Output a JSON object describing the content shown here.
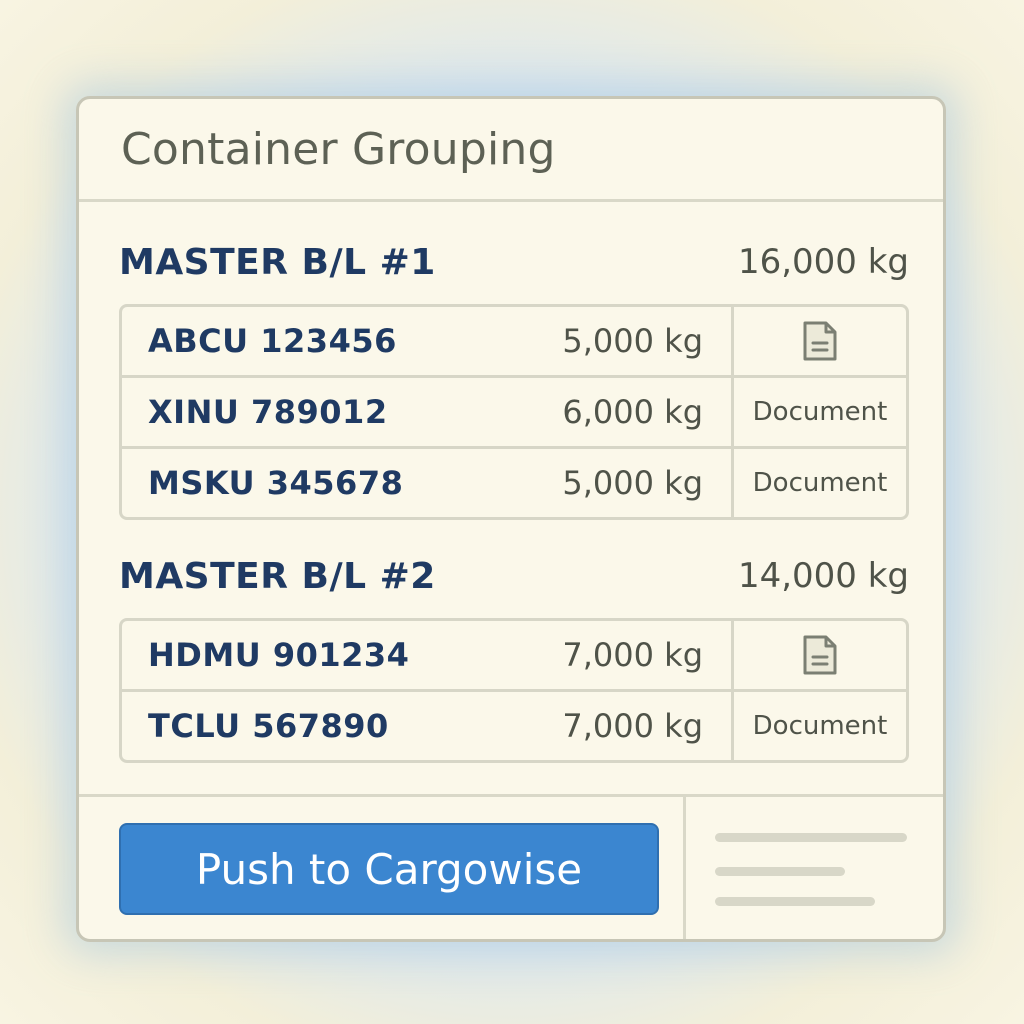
{
  "panel": {
    "title": "Container Grouping"
  },
  "groups": [
    {
      "title": "MASTER B/L #1",
      "total_weight": "16,000 kg",
      "containers": [
        {
          "id": "ABCU 123456",
          "weight": "5,000 kg",
          "doc": {
            "type": "icon",
            "icon": "document-icon",
            "label": ""
          }
        },
        {
          "id": "XINU 789012",
          "weight": "6,000 kg",
          "doc": {
            "type": "text",
            "icon": "",
            "label": "Document"
          }
        },
        {
          "id": "MSKU 345678",
          "weight": "5,000 kg",
          "doc": {
            "type": "text",
            "icon": "",
            "label": "Document"
          }
        }
      ]
    },
    {
      "title": "MASTER B/L #2",
      "total_weight": "14,000 kg",
      "containers": [
        {
          "id": "HDMU 901234",
          "weight": "7,000 kg",
          "doc": {
            "type": "icon",
            "icon": "document-icon",
            "label": ""
          }
        },
        {
          "id": "TCLU 567890",
          "weight": "7,000 kg",
          "doc": {
            "type": "text",
            "icon": "",
            "label": "Document"
          }
        }
      ]
    }
  ],
  "footer": {
    "push_label": "Push to Cargowise"
  },
  "colors": {
    "accent": "#3b86d0",
    "heading": "#1f3a63",
    "panel_bg": "#fbf8ea"
  }
}
